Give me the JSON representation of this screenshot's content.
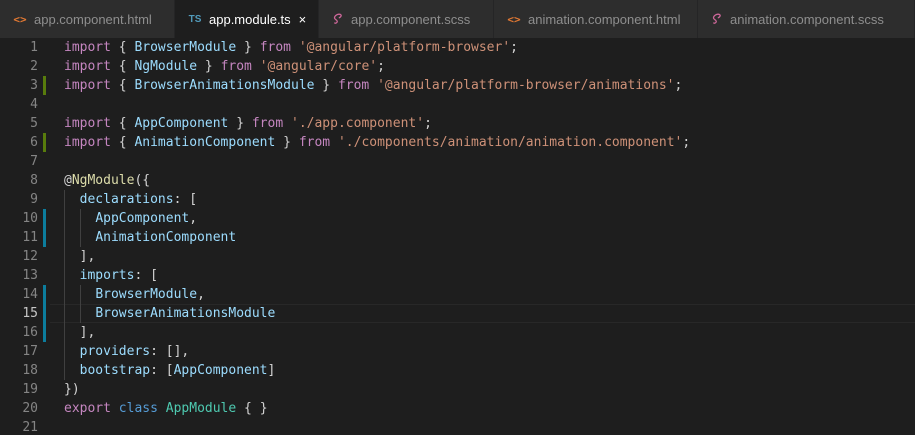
{
  "tabs": [
    {
      "label": "app.component.html",
      "icon": "html-file-icon",
      "glyph": "<>",
      "active": false
    },
    {
      "label": "app.module.ts",
      "icon": "typescript-file-icon",
      "glyph": "TS",
      "active": true
    },
    {
      "label": "app.component.scss",
      "icon": "sass-file-icon",
      "glyph": "",
      "active": false
    },
    {
      "label": "animation.component.html",
      "icon": "html-file-icon",
      "glyph": "<>",
      "active": false
    },
    {
      "label": "animation.component.scss",
      "icon": "sass-file-icon",
      "glyph": "",
      "active": false
    }
  ],
  "close_glyph": "×",
  "editor": {
    "current_line": 15,
    "lines": [
      {
        "n": "1",
        "mark": "",
        "guides": [],
        "tokens": [
          [
            "ctl",
            "import"
          ],
          [
            "pun",
            " { "
          ],
          [
            "id",
            "BrowserModule"
          ],
          [
            "pun",
            " } "
          ],
          [
            "ctl",
            "from"
          ],
          [
            "pun",
            " "
          ],
          [
            "str",
            "'@angular/platform-browser'"
          ],
          [
            "pun",
            ";"
          ]
        ]
      },
      {
        "n": "2",
        "mark": "",
        "guides": [],
        "tokens": [
          [
            "ctl",
            "import"
          ],
          [
            "pun",
            " { "
          ],
          [
            "id",
            "NgModule"
          ],
          [
            "pun",
            " } "
          ],
          [
            "ctl",
            "from"
          ],
          [
            "pun",
            " "
          ],
          [
            "str",
            "'@angular/core'"
          ],
          [
            "pun",
            ";"
          ]
        ]
      },
      {
        "n": "3",
        "mark": "added",
        "guides": [],
        "tokens": [
          [
            "ctl",
            "import"
          ],
          [
            "pun",
            " { "
          ],
          [
            "id",
            "BrowserAnimationsModule"
          ],
          [
            "pun",
            " } "
          ],
          [
            "ctl",
            "from"
          ],
          [
            "pun",
            " "
          ],
          [
            "str",
            "'@angular/platform-browser/animations'"
          ],
          [
            "pun",
            ";"
          ]
        ]
      },
      {
        "n": "4",
        "mark": "",
        "guides": [],
        "tokens": []
      },
      {
        "n": "5",
        "mark": "",
        "guides": [],
        "tokens": [
          [
            "ctl",
            "import"
          ],
          [
            "pun",
            " { "
          ],
          [
            "id",
            "AppComponent"
          ],
          [
            "pun",
            " } "
          ],
          [
            "ctl",
            "from"
          ],
          [
            "pun",
            " "
          ],
          [
            "str",
            "'./app.component'"
          ],
          [
            "pun",
            ";"
          ]
        ]
      },
      {
        "n": "6",
        "mark": "added",
        "guides": [],
        "tokens": [
          [
            "ctl",
            "import"
          ],
          [
            "pun",
            " { "
          ],
          [
            "id",
            "AnimationComponent"
          ],
          [
            "pun",
            " } "
          ],
          [
            "ctl",
            "from"
          ],
          [
            "pun",
            " "
          ],
          [
            "str",
            "'./components/animation/animation.component'"
          ],
          [
            "pun",
            ";"
          ]
        ]
      },
      {
        "n": "7",
        "mark": "",
        "guides": [],
        "tokens": []
      },
      {
        "n": "8",
        "mark": "",
        "guides": [],
        "tokens": [
          [
            "pun",
            "@"
          ],
          [
            "fn",
            "NgModule"
          ],
          [
            "pun",
            "({"
          ]
        ]
      },
      {
        "n": "9",
        "mark": "",
        "guides": [
          1
        ],
        "tokens": [
          [
            "pun",
            "  "
          ],
          [
            "id",
            "declarations"
          ],
          [
            "pun",
            ": ["
          ]
        ]
      },
      {
        "n": "10",
        "mark": "modified",
        "guides": [
          1,
          2
        ],
        "tokens": [
          [
            "pun",
            "    "
          ],
          [
            "id",
            "AppComponent"
          ],
          [
            "pun",
            ","
          ]
        ]
      },
      {
        "n": "11",
        "mark": "modified",
        "guides": [
          1,
          2
        ],
        "tokens": [
          [
            "pun",
            "    "
          ],
          [
            "id",
            "AnimationComponent"
          ]
        ]
      },
      {
        "n": "12",
        "mark": "",
        "guides": [
          1
        ],
        "tokens": [
          [
            "pun",
            "  ],"
          ]
        ]
      },
      {
        "n": "13",
        "mark": "",
        "guides": [
          1
        ],
        "tokens": [
          [
            "pun",
            "  "
          ],
          [
            "id",
            "imports"
          ],
          [
            "pun",
            ": ["
          ]
        ]
      },
      {
        "n": "14",
        "mark": "modified",
        "guides": [
          1,
          2
        ],
        "tokens": [
          [
            "pun",
            "    "
          ],
          [
            "id",
            "BrowserModule"
          ],
          [
            "pun",
            ","
          ]
        ]
      },
      {
        "n": "15",
        "mark": "modified",
        "guides": [
          1,
          2
        ],
        "tokens": [
          [
            "pun",
            "    "
          ],
          [
            "id",
            "BrowserAnimationsModule"
          ]
        ]
      },
      {
        "n": "16",
        "mark": "modified",
        "guides": [
          1
        ],
        "tokens": [
          [
            "pun",
            "  ],"
          ]
        ]
      },
      {
        "n": "17",
        "mark": "",
        "guides": [
          1
        ],
        "tokens": [
          [
            "pun",
            "  "
          ],
          [
            "id",
            "providers"
          ],
          [
            "pun",
            ": [],"
          ]
        ]
      },
      {
        "n": "18",
        "mark": "",
        "guides": [
          1
        ],
        "tokens": [
          [
            "pun",
            "  "
          ],
          [
            "id",
            "bootstrap"
          ],
          [
            "pun",
            ": ["
          ],
          [
            "id",
            "AppComponent"
          ],
          [
            "pun",
            "]"
          ]
        ]
      },
      {
        "n": "19",
        "mark": "",
        "guides": [],
        "tokens": [
          [
            "pun",
            "})"
          ]
        ]
      },
      {
        "n": "20",
        "mark": "",
        "guides": [],
        "tokens": [
          [
            "ctl",
            "export"
          ],
          [
            "pun",
            " "
          ],
          [
            "kw",
            "class"
          ],
          [
            "pun",
            " "
          ],
          [
            "cls",
            "AppModule"
          ],
          [
            "pun",
            " { }"
          ]
        ]
      },
      {
        "n": "21",
        "mark": "",
        "guides": [],
        "tokens": []
      }
    ]
  },
  "colors": {
    "editor_bg": "#1e1e1e",
    "tab_inactive_bg": "#2d2d2d",
    "gutter_added": "#587c0c",
    "gutter_modified": "#0c7d9d"
  }
}
